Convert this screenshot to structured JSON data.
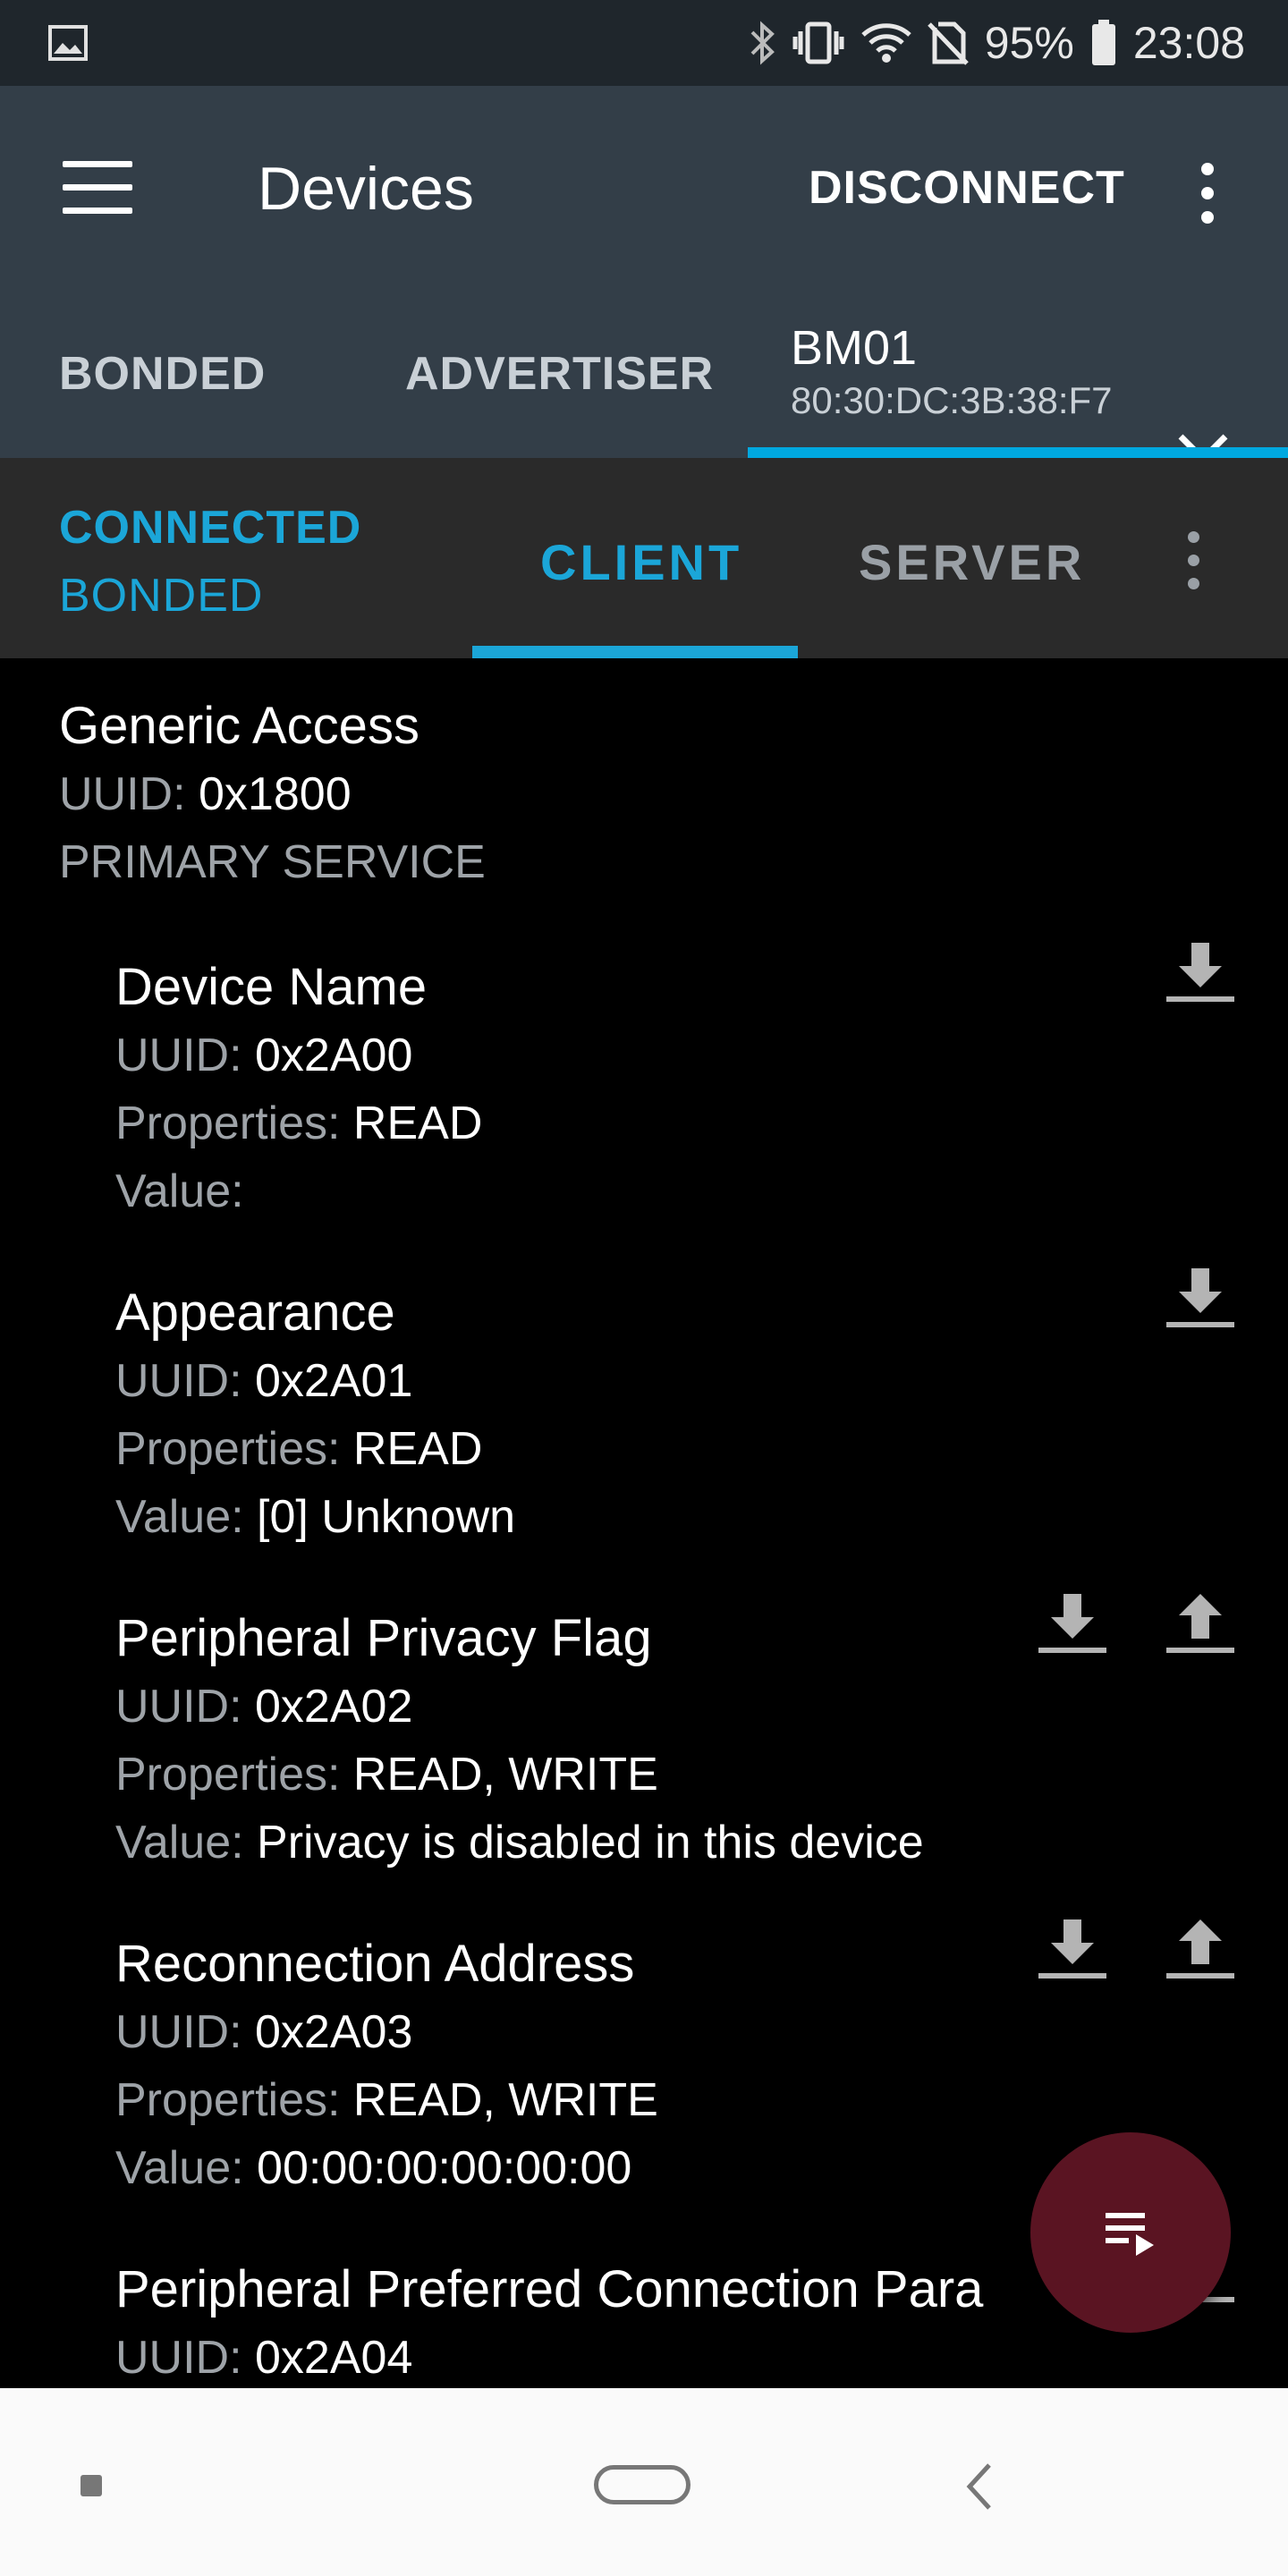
{
  "status_bar": {
    "battery": "95%",
    "time": "23:08",
    "icons": [
      "image-icon",
      "bluetooth-icon",
      "vibrate-icon",
      "wifi-icon",
      "no-sim-icon",
      "battery-icon"
    ]
  },
  "app_bar": {
    "title": "Devices",
    "disconnect_label": "DISCONNECT"
  },
  "device_tabs": [
    {
      "label": "BONDED"
    },
    {
      "label": "ADVERTISER"
    },
    {
      "label": "BM01",
      "address": "80:30:DC:3B:38:F7",
      "selected": true
    }
  ],
  "connection": {
    "state": "CONNECTED",
    "bond_state": "BONDED"
  },
  "sub_tabs": [
    {
      "label": "CLIENT",
      "selected": true
    },
    {
      "label": "SERVER"
    }
  ],
  "labels": {
    "uuid": "UUID:",
    "properties": "Properties:",
    "value": "Value:"
  },
  "service": {
    "name": "Generic Access",
    "uuid": "0x1800",
    "type": "PRIMARY SERVICE"
  },
  "characteristics": [
    {
      "name": "Device Name",
      "uuid": "0x2A00",
      "properties": "READ",
      "value": ""
    },
    {
      "name": "Appearance",
      "uuid": "0x2A01",
      "properties": "READ",
      "value": "[0] Unknown"
    },
    {
      "name": "Peripheral Privacy Flag",
      "uuid": "0x2A02",
      "properties": "READ, WRITE",
      "value": "Privacy is disabled in this device"
    },
    {
      "name": "Reconnection Address",
      "uuid": "0x2A03",
      "properties": "READ, WRITE",
      "value": "00:00:00:00:00:00"
    },
    {
      "name": "Peripheral Preferred Connection Para",
      "uuid": "0x2A04"
    }
  ],
  "colors": {
    "app_bar": "#333e48",
    "accent": "#1ba6d8",
    "tab_indicator": "#00a8e0",
    "fab": "#5a1422"
  }
}
